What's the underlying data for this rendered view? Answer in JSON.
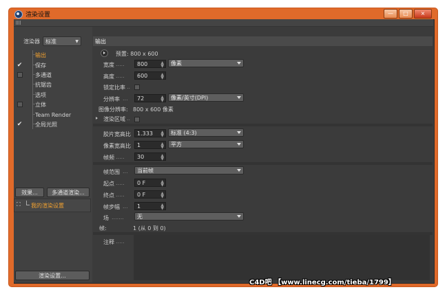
{
  "window": {
    "title": "渲染设置",
    "buttons": [
      "—",
      "□",
      "×"
    ]
  },
  "left_panel": {
    "renderer_label": "渲染器",
    "renderer_value": "标准",
    "tree": [
      {
        "label": "输出",
        "check": "",
        "active": true
      },
      {
        "label": "保存",
        "check": "✔",
        "active": false
      },
      {
        "label": "多通道",
        "check": "box",
        "active": false
      },
      {
        "label": "抗锯齿",
        "check": "",
        "active": false
      },
      {
        "label": "选项",
        "check": "",
        "active": false
      },
      {
        "label": "立体",
        "check": "box",
        "active": false
      },
      {
        "label": "Team Render",
        "check": "",
        "active": false
      },
      {
        "label": "全局光照",
        "check": "✔",
        "active": false
      }
    ],
    "effects_button": "效果...",
    "multipass_button": "多通道渲染...",
    "preset_item": "我的渲染设置",
    "render_settings_button": "渲染设置..."
  },
  "right_panel": {
    "section_title": "输出",
    "preset": "预置: 800 x 600",
    "width_label": "宽度",
    "width_value": "800",
    "unit_value": "像素",
    "height_label": "高度",
    "height_value": "600",
    "lock_ratio_label": "锁定比率",
    "resolution_label": "分辨率",
    "resolution_value": "72",
    "resolution_unit": "像素/英寸(DPI)",
    "image_resolution_label": "图像分辨率:",
    "image_resolution_value": "800 x 600 像素",
    "render_region_label": "渲染区域",
    "film_aspect_label": "胶片宽高比",
    "film_aspect_value": "1.333",
    "film_aspect_preset": "标准 (4:3)",
    "pixel_aspect_label": "像素宽高比",
    "pixel_aspect_value": "1",
    "pixel_aspect_preset": "平方",
    "fps_label": "帧频",
    "fps_value": "30",
    "frame_range_label": "帧范围",
    "frame_range_value": "当前帧",
    "start_label": "起点",
    "start_value": "0 F",
    "end_label": "终点",
    "end_value": "0 F",
    "frame_step_label": "帧步幅",
    "frame_step_value": "1",
    "fields_label": "场",
    "fields_value": "无",
    "frames_label": "帧:",
    "frames_value": "1 (从 0 到 0)",
    "notes_label": "注释"
  },
  "watermark": "C4D吧 【www.linecg.com/tieba/1799】"
}
